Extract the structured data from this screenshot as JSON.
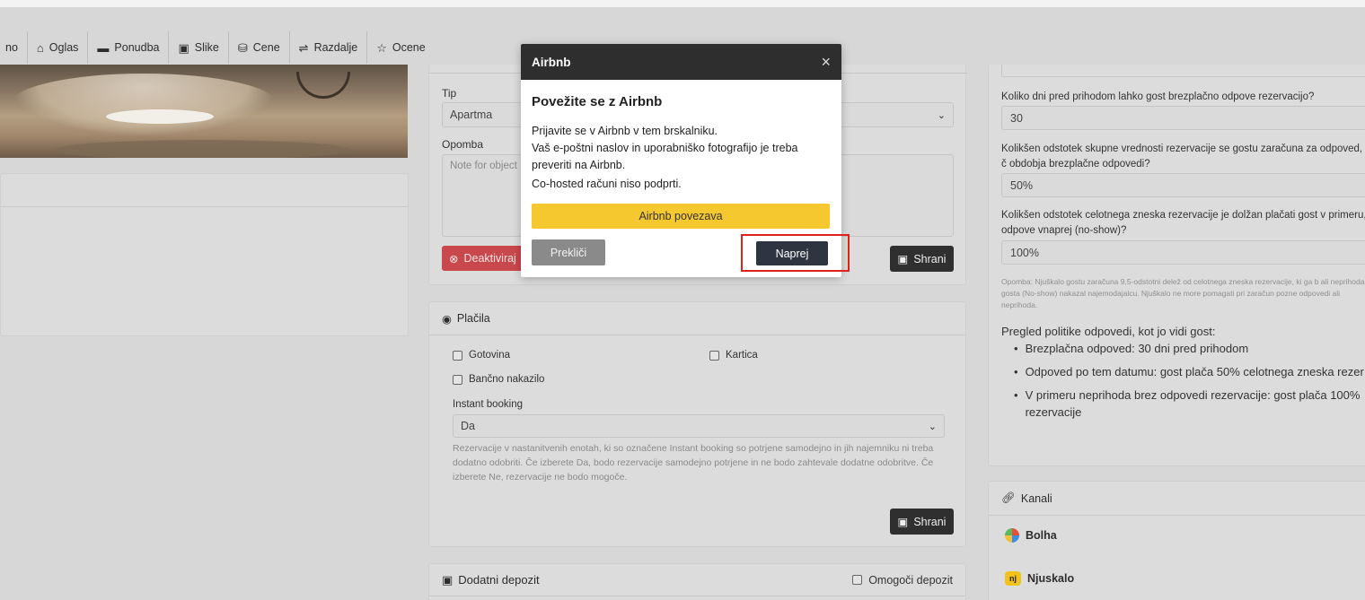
{
  "tabs": [
    {
      "label": "no",
      "icon": ""
    },
    {
      "label": "Oglas",
      "icon": "home-icon"
    },
    {
      "label": "Ponudba",
      "icon": "sofa-icon"
    },
    {
      "label": "Slike",
      "icon": "images-icon"
    },
    {
      "label": "Cene",
      "icon": "coins-icon"
    },
    {
      "label": "Razdalje",
      "icon": "signpost-icon"
    },
    {
      "label": "Ocene",
      "icon": "star-icon"
    }
  ],
  "form": {
    "tip_label": "Tip",
    "tip_value": "Apartma",
    "opomba_label": "Opomba",
    "opomba_placeholder": "Note for object",
    "deactivate_label": "Deaktiviraj",
    "save_label": "Shrani"
  },
  "payments": {
    "title": "Plačila",
    "gotovina": "Gotovina",
    "kartica": "Kartica",
    "bancno": "Bančno nakazilo",
    "instant_label": "Instant booking",
    "instant_value": "Da",
    "help": "Rezervacije v nastanitvenih enotah, ki so označene Instant booking so potrjene samodejno in jih najemniku ni treba dodatno odobriti. Če izberete Da, bodo rezervacije samodejno potrjene in ne bodo zahtevale dodatne odobritve. Če izberete Ne, rezervacije ne bodo mogoče.",
    "save_label": "Shrani"
  },
  "deposit": {
    "title": "Dodatni depozit",
    "enable_label": "Omogoči depozit"
  },
  "policy": {
    "q1": "Koliko dni pred prihodom lahko gost brezplačno odpove rezervacijo?",
    "v1": "30",
    "q2": "Kolikšen odstotek skupne vrednosti rezervacije se gostu zaračuna za odpoved, č obdobja brezplačne odpovedi?",
    "v2": "50%",
    "q3": "Kolikšen odstotek celotnega zneska rezervacije je dolžan plačati gost v primeru, odpove vnaprej (no-show)?",
    "v3": "100%",
    "note": "Opomba: Njuškalo gostu zaračuna 9,5-odstotni delež od celotnega zneska rezervacije, ki ga b ali neprihoda gosta (No-show) nakazal najemodajalcu. Njuškalo ne more pomagati pri zaračun pozne odpovedi ali neprihoda.",
    "overview_title": "Pregled politike odpovedi, kot jo vidi gost:",
    "items": [
      "Brezplačna odpoved: 30 dni pred prihodom",
      "Odpoved po tem datumu: gost plača 50% celotnega zneska rezer",
      "V primeru neprihoda brez odpovedi rezervacije: gost plača 100% rezervacije"
    ]
  },
  "channels": {
    "title": "Kanali",
    "items": [
      "Bolha",
      "Njuskalo"
    ]
  },
  "modal": {
    "header": "Airbnb",
    "close": "×",
    "title": "Povežite se z Airbnb",
    "line1": "Prijavite se v Airbnb v tem brskalniku.",
    "line2": "Vaš e-poštni naslov in uporabniško fotografijo je treba preveriti na Airbnb.",
    "line3": "Co-hosted računi niso podprti.",
    "airbnb_button": "Airbnb povezava",
    "cancel_button": "Prekliči",
    "next_button": "Naprej"
  },
  "colors": {
    "overlay_bg": "#d7d7d7",
    "modal_header": "#2e2e2e",
    "airbnb_yellow": "#f6c830",
    "deactivate_red": "#c9484c",
    "highlight_red": "#e0201f"
  }
}
